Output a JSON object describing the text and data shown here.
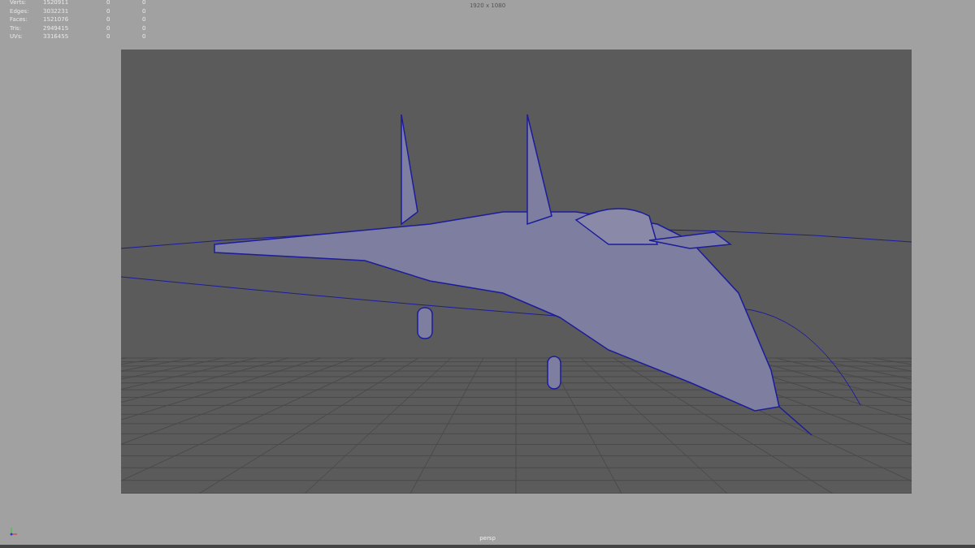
{
  "hud_stats": [
    {
      "label": "Verts:",
      "value": "1520911",
      "column_3": "0",
      "column_4": "0"
    },
    {
      "label": "Edges:",
      "value": "3032231",
      "column_3": "0",
      "column_4": "0"
    },
    {
      "label": "Faces:",
      "value": "1521076",
      "column_3": "0",
      "column_4": "0"
    },
    {
      "label": "Tris:",
      "value": "2949415",
      "column_3": "0",
      "column_4": "0"
    },
    {
      "label": "UVs:",
      "value": "3316455",
      "column_3": "0",
      "column_4": "0"
    }
  ],
  "resolution": "1920 x 1080",
  "camera": "persp"
}
